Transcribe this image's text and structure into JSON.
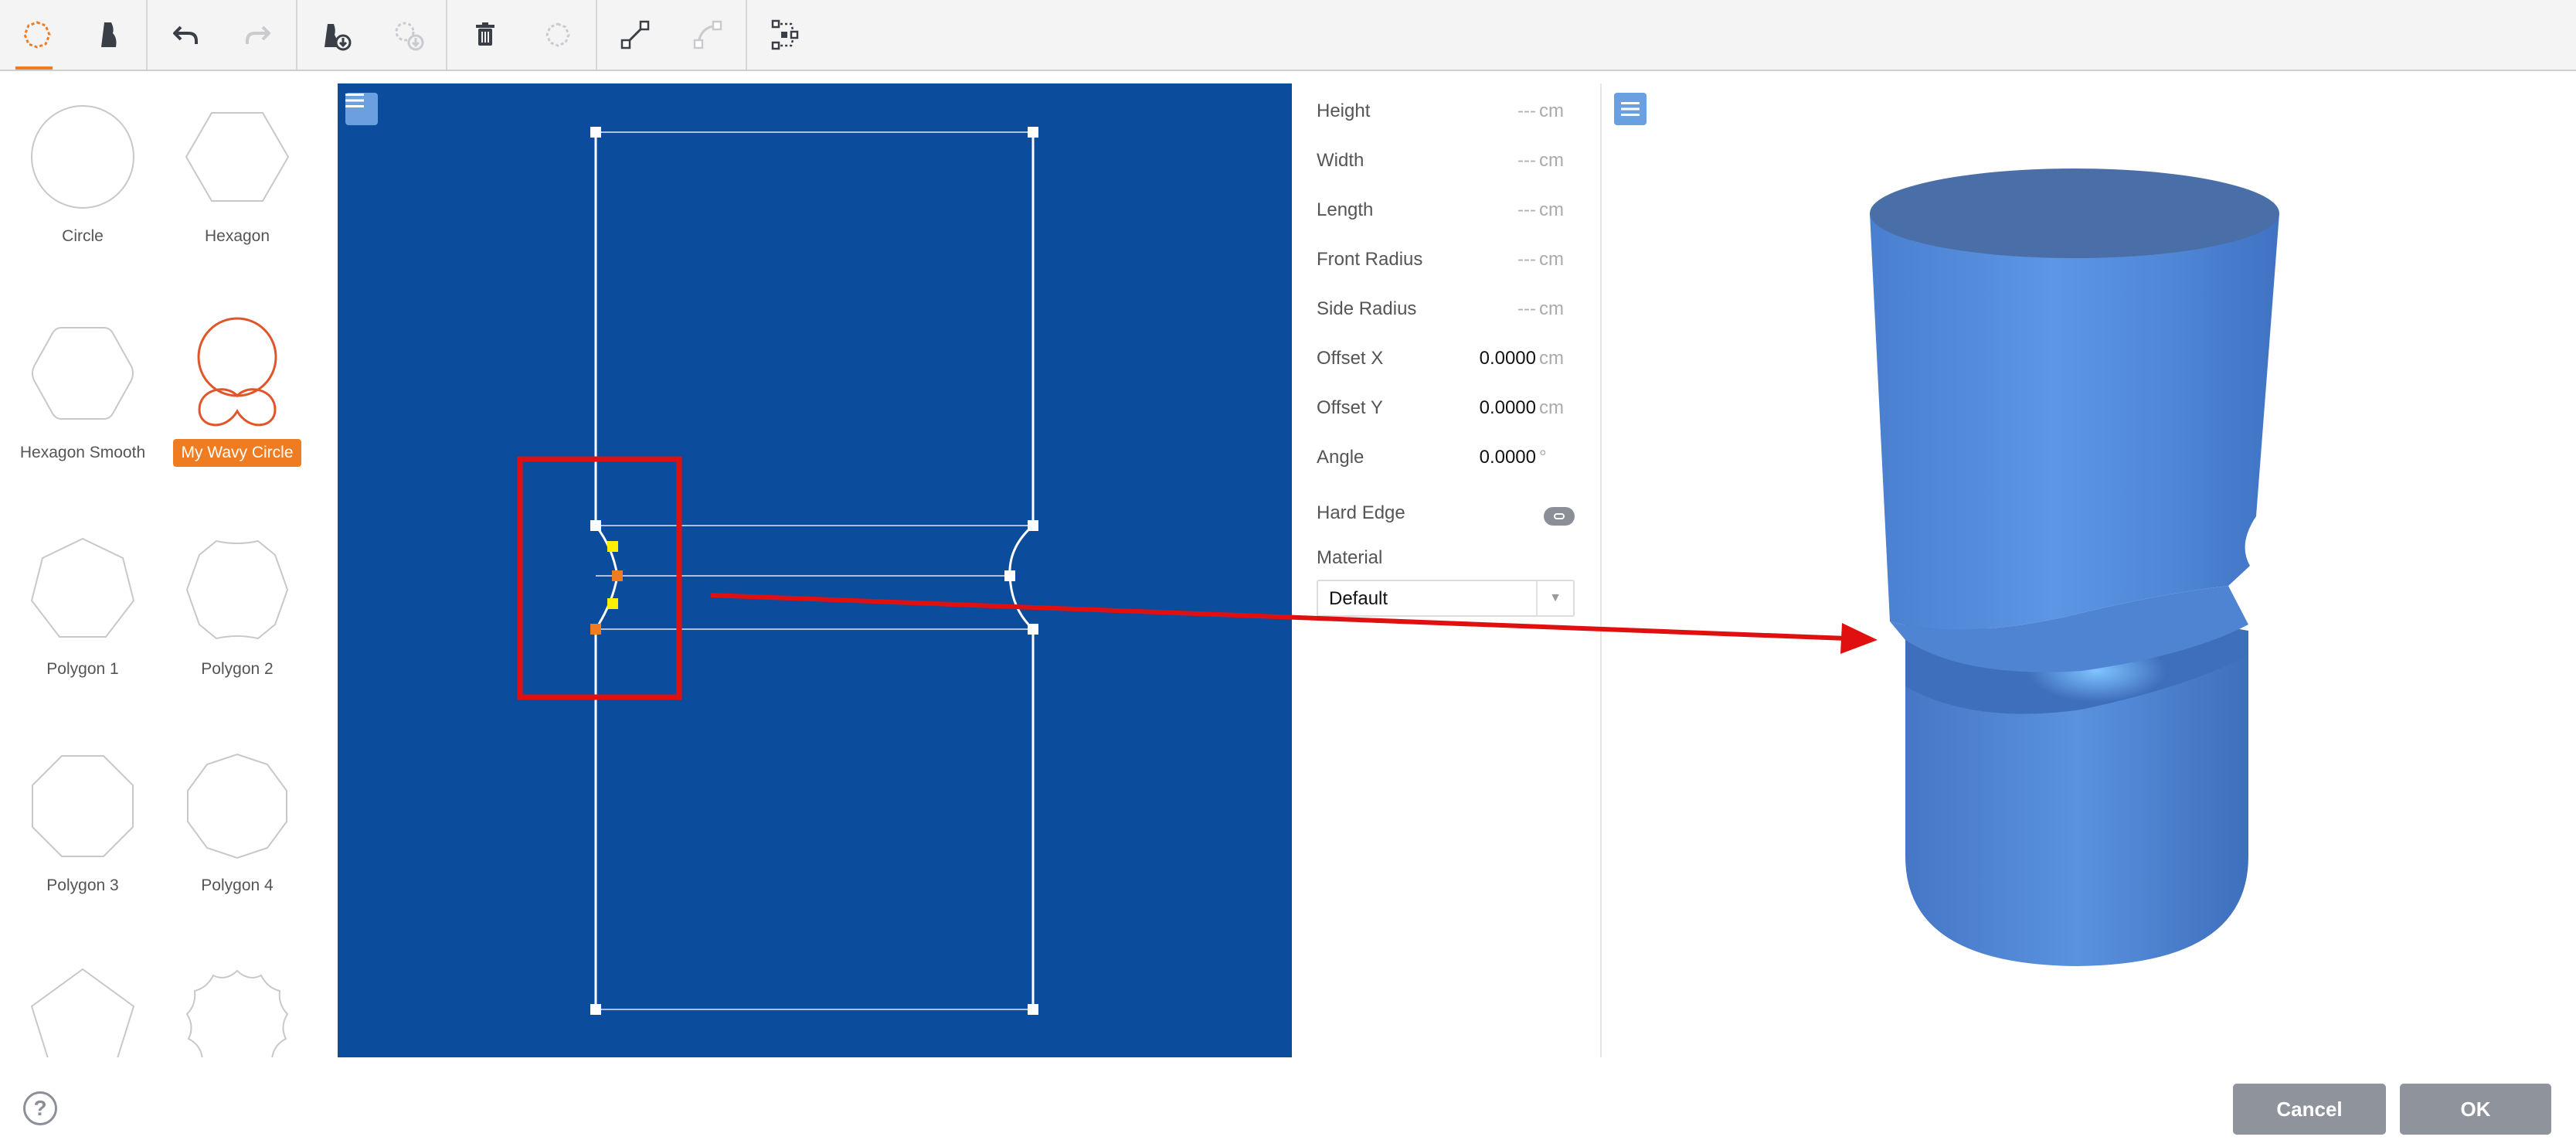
{
  "toolbar": {
    "buttons": [
      {
        "icon": "shape-outline-icon",
        "active": true
      },
      {
        "icon": "profile-icon"
      },
      {
        "icon": "undo-icon"
      },
      {
        "icon": "redo-icon",
        "disabled": true
      },
      {
        "icon": "import-profile-icon"
      },
      {
        "icon": "import-shape-icon",
        "disabled": true
      },
      {
        "icon": "trash-icon"
      },
      {
        "icon": "reset-shape-icon",
        "disabled": true
      },
      {
        "icon": "line-segment-icon"
      },
      {
        "icon": "curve-segment-icon",
        "disabled": true
      },
      {
        "icon": "node-edit-icon"
      }
    ],
    "accent_color": "#f07c22"
  },
  "shape_library": {
    "items": [
      {
        "label": "Circle",
        "shape": "circle"
      },
      {
        "label": "Hexagon",
        "shape": "hexagon"
      },
      {
        "label": "Hexagon Smooth",
        "shape": "hexagon-smooth"
      },
      {
        "label": "My Wavy Circle",
        "shape": "wavy-circle",
        "selected": true
      },
      {
        "label": "Polygon 1",
        "shape": "polygon-7"
      },
      {
        "label": "Polygon 2",
        "shape": "polygon-wavy-8"
      },
      {
        "label": "Polygon 3",
        "shape": "octagon"
      },
      {
        "label": "Polygon 4",
        "shape": "decagon"
      },
      {
        "label": "",
        "shape": "pentagon-partial"
      },
      {
        "label": "",
        "shape": "wavy-partial"
      }
    ]
  },
  "editor_2d": {
    "background_color": "#0b4c9c",
    "menu_icon": "menu-icon"
  },
  "properties": {
    "height": {
      "label": "Height",
      "value": "---",
      "unit": "cm"
    },
    "width": {
      "label": "Width",
      "value": "---",
      "unit": "cm"
    },
    "length": {
      "label": "Length",
      "value": "---",
      "unit": "cm"
    },
    "front_radius": {
      "label": "Front Radius",
      "value": "---",
      "unit": "cm"
    },
    "side_radius": {
      "label": "Side Radius",
      "value": "---",
      "unit": "cm"
    },
    "offset_x": {
      "label": "Offset X",
      "value": "0.0000",
      "unit": "cm"
    },
    "offset_y": {
      "label": "Offset Y",
      "value": "0.0000",
      "unit": "cm"
    },
    "angle": {
      "label": "Angle",
      "value": "0.0000",
      "unit": "°"
    },
    "hard_edge": {
      "label": "Hard Edge"
    },
    "material": {
      "label": "Material",
      "selected": "Default"
    }
  },
  "view_3d": {
    "menu_icon": "menu-icon",
    "model_color": "#4f86d6"
  },
  "annotation": {
    "highlight_color": "#e01010"
  },
  "footer": {
    "help_label": "?",
    "cancel_label": "Cancel",
    "ok_label": "OK"
  }
}
